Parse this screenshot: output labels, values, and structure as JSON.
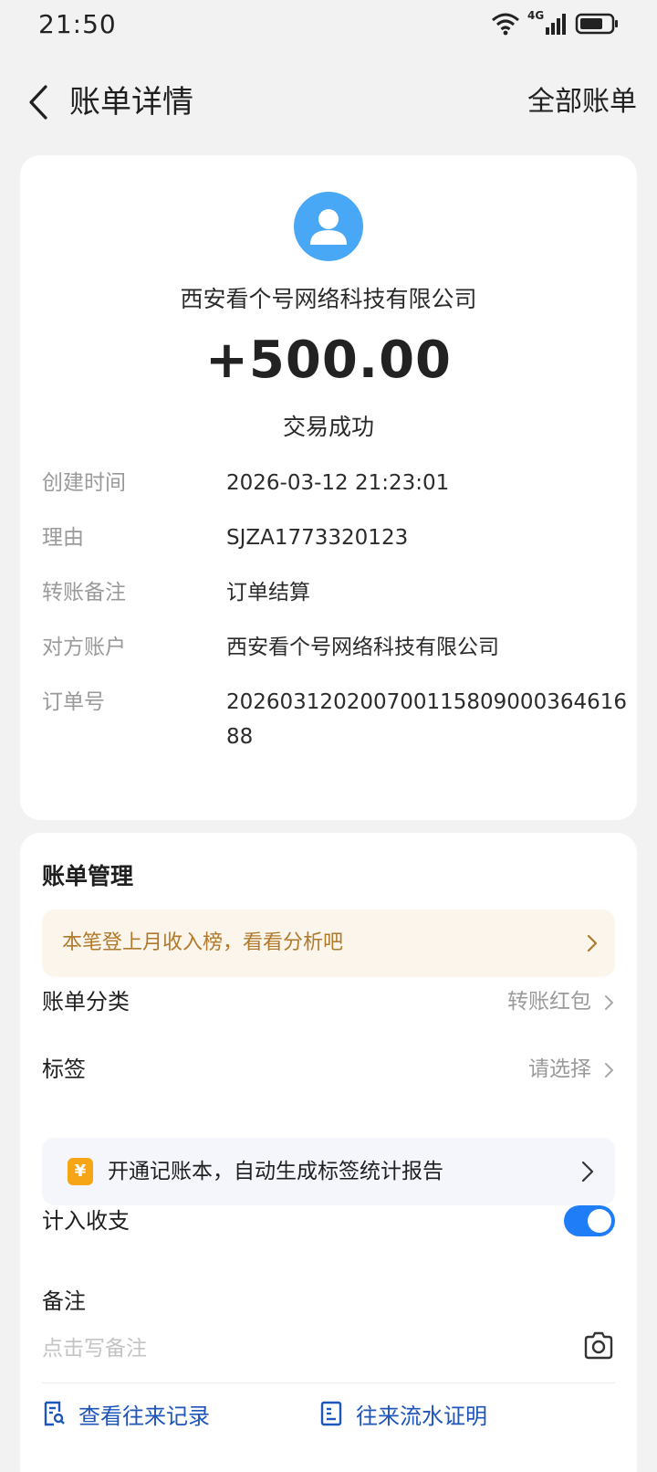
{
  "status_bar": {
    "time": "21:50",
    "network": "4G"
  },
  "nav": {
    "title": "账单详情",
    "right_link": "全部账单"
  },
  "transaction": {
    "payee": "西安看个号网络科技有限公司",
    "amount": "+500.00",
    "status": "交易成功"
  },
  "details": [
    {
      "label": "创建时间",
      "value": "2026-03-12 21:23:01"
    },
    {
      "label": "理由",
      "value": "SJZA1773320123"
    },
    {
      "label": "转账备注",
      "value": "订单结算"
    },
    {
      "label": "对方账户",
      "value": "西安看个号网络科技有限公司"
    },
    {
      "label": "订单号",
      "value": "20260312020070011580900036461688"
    }
  ],
  "manage": {
    "title": "账单管理",
    "banner_text": "本笔登上月收入榜，看看分析吧",
    "category_label": "账单分类",
    "category_value": "转账红包",
    "tag_label": "标签",
    "tag_value": "请选择",
    "promo_icon": "¥",
    "promo_text": "开通记账本，自动生成标签统计报告",
    "include_label": "计入收支",
    "include_on": true,
    "note_label": "备注",
    "note_placeholder": "点击写备注",
    "link_history": "查看往来记录",
    "link_proof": "往来流水证明"
  },
  "colors": {
    "accent": "#1f7ef7",
    "banner_text": "#b07a2c",
    "avatar_bg": "#49a8f6",
    "link": "#1e55b8"
  }
}
